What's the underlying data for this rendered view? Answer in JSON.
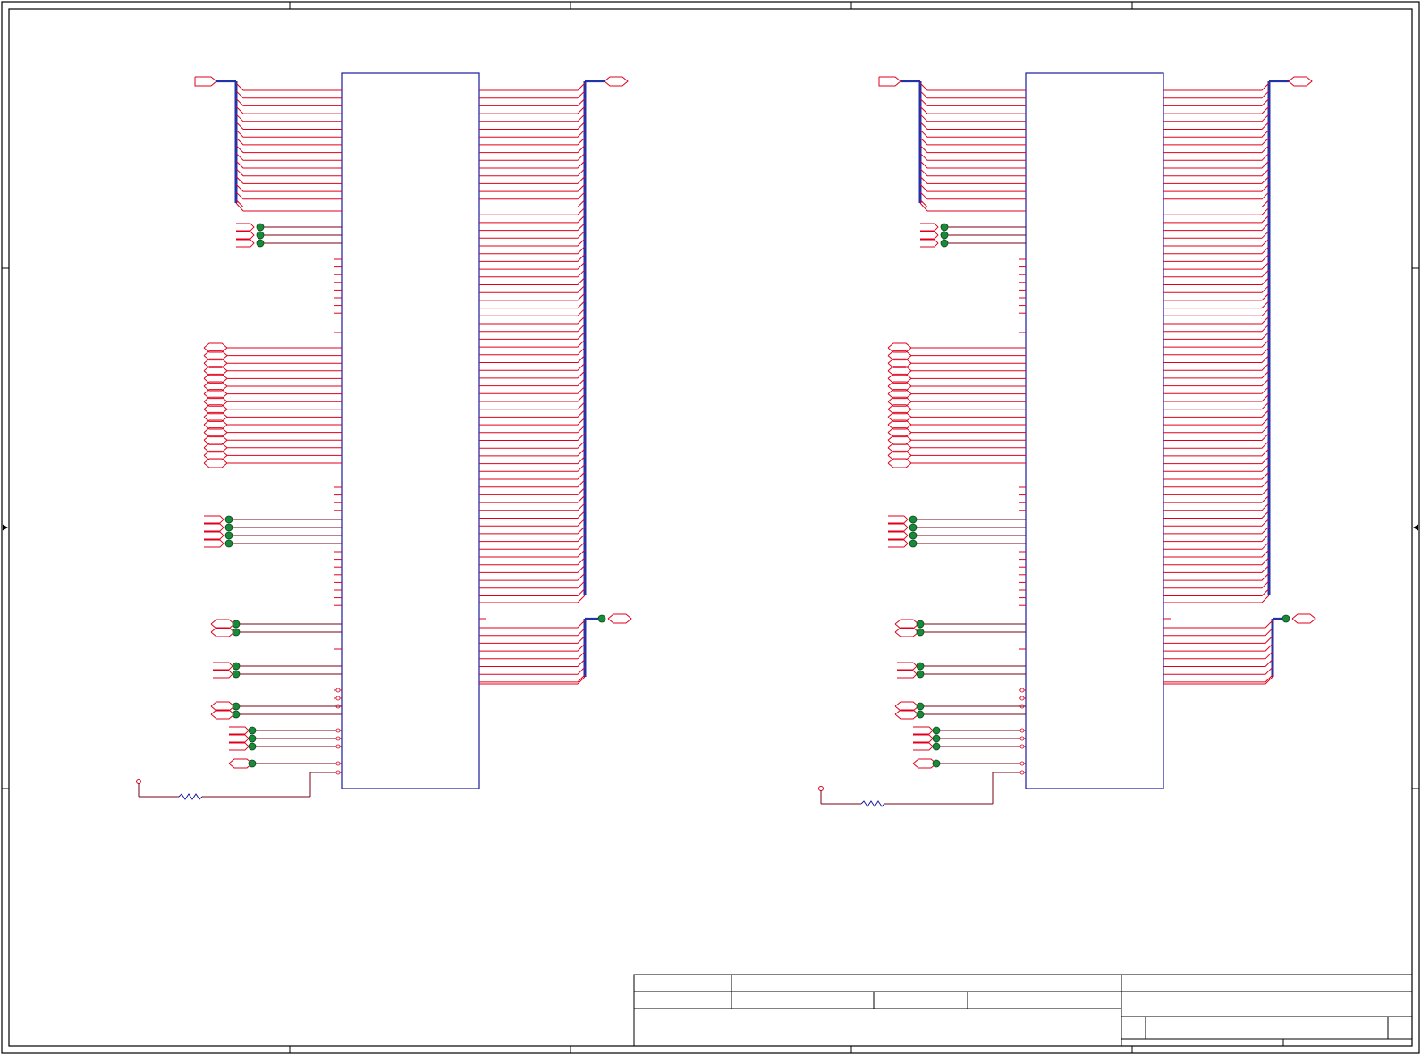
{
  "sheet": {
    "title_block": {
      "fields": []
    }
  },
  "colors": {
    "wire": "#e0001b",
    "wire_dark": "#7a0010",
    "bus": "#2233aa",
    "component": "#1a1aa0",
    "frame": "#000000",
    "junction": "#1a8a3a",
    "port": "#e0001b"
  },
  "schematic": {
    "blocks": [
      {
        "id": "left",
        "chip_label": "",
        "left_bus_pins": 16,
        "left_group_a_pins": 3,
        "left_nc_pins": 8,
        "left_port_group_pins": 16,
        "left_nc_pins_2": 4,
        "left_group_b_pins": 4,
        "left_nc_pins_3": 8,
        "left_pair_1_pins": 2,
        "left_pair_2_pins": 2,
        "left_pair_3_pins": 2,
        "left_triple_pins": 3,
        "left_single_pins": 1,
        "right_bus_pins": 66,
        "right_small_bus_pins": 9,
        "resistor": true
      },
      {
        "id": "right",
        "chip_label": "",
        "left_bus_pins": 16,
        "left_group_a_pins": 3,
        "left_nc_pins": 8,
        "left_port_group_pins": 16,
        "left_nc_pins_2": 4,
        "left_group_b_pins": 4,
        "left_nc_pins_3": 8,
        "left_pair_1_pins": 2,
        "left_pair_2_pins": 2,
        "left_pair_3_pins": 2,
        "left_triple_pins": 3,
        "left_single_pins": 1,
        "right_bus_pins": 66,
        "right_small_bus_pins": 9,
        "resistor": true
      }
    ]
  }
}
